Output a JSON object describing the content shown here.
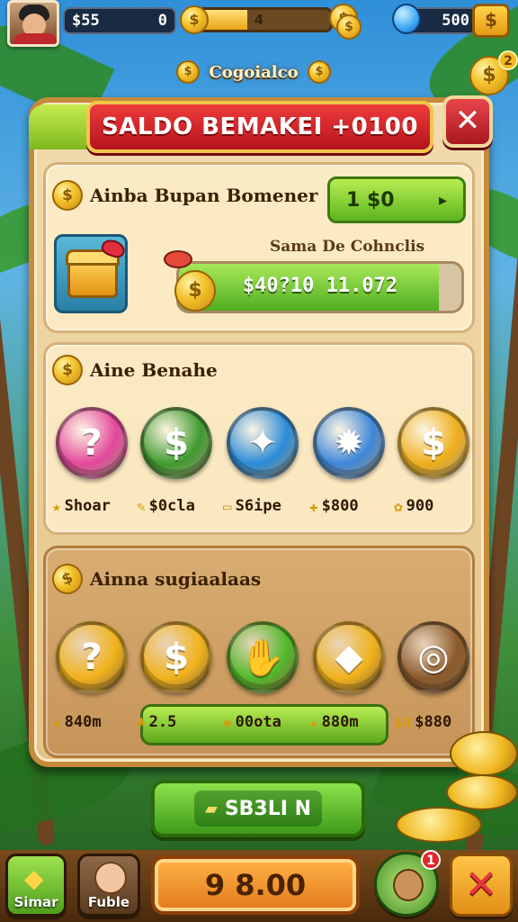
{
  "topbar": {
    "coins_label": "$55",
    "coins_value": "0",
    "xp_text": "4",
    "xp_progress": 0.42,
    "gems_value": "500",
    "add_label": "$",
    "corner_coin_badge": "2"
  },
  "screen_subtitle": "Cogoialco",
  "dialog": {
    "title": "SALDO BEMAKEI +0100",
    "close_label": "✕"
  },
  "balance_section": {
    "heading": "Ainba Bupan Bomener",
    "claim_button_value": "1 $0",
    "claim_button_arrow": "▸",
    "progress_caption": "Sama De Cohnclis",
    "progress_text": "$40?10 11.072",
    "progress_value": 0.92
  },
  "rewards_section": {
    "heading": "Aine Benahe",
    "items": [
      {
        "icon": "question-mark-icon",
        "glyph": "?",
        "label": "Shoar",
        "label_icon": "★",
        "color": "#e3479b"
      },
      {
        "icon": "dollar-icon",
        "glyph": "$",
        "label": "$0cla",
        "label_icon": "✎",
        "color": "#3f9a2f"
      },
      {
        "icon": "ticket-icon",
        "glyph": "✦",
        "label": "S6ipe",
        "label_icon": "▭",
        "color": "#2b8ad6"
      },
      {
        "icon": "gear-badge-icon",
        "glyph": "✹",
        "label": "$800",
        "label_icon": "✚",
        "color": "#3d86d8"
      },
      {
        "icon": "dollar-icon",
        "glyph": "$",
        "label": "900",
        "label_icon": "✿",
        "color": "#eeae1c"
      }
    ]
  },
  "suggestions_section": {
    "heading": "Ainna sugiaalaas",
    "items": [
      {
        "icon": "question-mark-icon",
        "glyph": "?",
        "label": "840m",
        "label_icon": "★",
        "color": "#f0b21c"
      },
      {
        "icon": "dollar-icon",
        "glyph": "$",
        "label": "2.5",
        "label_icon": "♣",
        "color": "#f0b21c"
      },
      {
        "icon": "leaf-icon",
        "glyph": "✋",
        "label": "00ota",
        "label_icon": "✱",
        "color": "#52b82a"
      },
      {
        "icon": "crystal-icon",
        "glyph": "◆",
        "label": "880m",
        "label_icon": "★",
        "color": "#f0b21c"
      },
      {
        "icon": "swirl-icon",
        "glyph": "◎",
        "label": "$880",
        "label_icon": "$4",
        "color": "#8a5a2c"
      }
    ]
  },
  "buy_button": {
    "label": "SB3LI N"
  },
  "bottom_nav": {
    "left_label": "Simar",
    "profile_label": "Fuble",
    "balance": "9 8.00",
    "pet_badge": "1"
  },
  "colors": {
    "panel_border": "#c58a3a",
    "title_red": "#c9202a",
    "accent_green": "#5cb51f",
    "gold": "#f0b822"
  }
}
